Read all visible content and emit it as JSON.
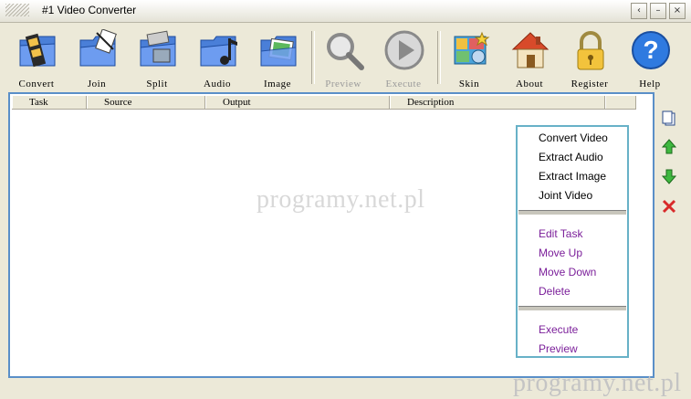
{
  "window": {
    "title": "#1 Video Converter",
    "controls": [
      "‹",
      "–",
      "×"
    ]
  },
  "toolbar": {
    "convert": "Convert",
    "join": "Join",
    "split": "Split",
    "audio": "Audio",
    "image": "Image",
    "preview": "Preview",
    "execute": "Execute",
    "skin": "Skin",
    "about": "About",
    "register": "Register",
    "help": "Help"
  },
  "table": {
    "columns": [
      "Task",
      "Source",
      "Output",
      "Description"
    ]
  },
  "context_menu": {
    "group1": [
      "Convert Video",
      "Extract Audio",
      "Extract Image",
      "Joint Video"
    ],
    "group2": [
      "Edit Task",
      "Move Up",
      "Move Down",
      "Delete"
    ],
    "group3": [
      "Execute",
      "Preview"
    ]
  },
  "watermark": "programy.net.pl",
  "colors": {
    "panel_border": "#5a8fc8",
    "menu_border": "#67b1c7",
    "menu_enabled": "#000000",
    "menu_other": "#7b1f9a"
  }
}
